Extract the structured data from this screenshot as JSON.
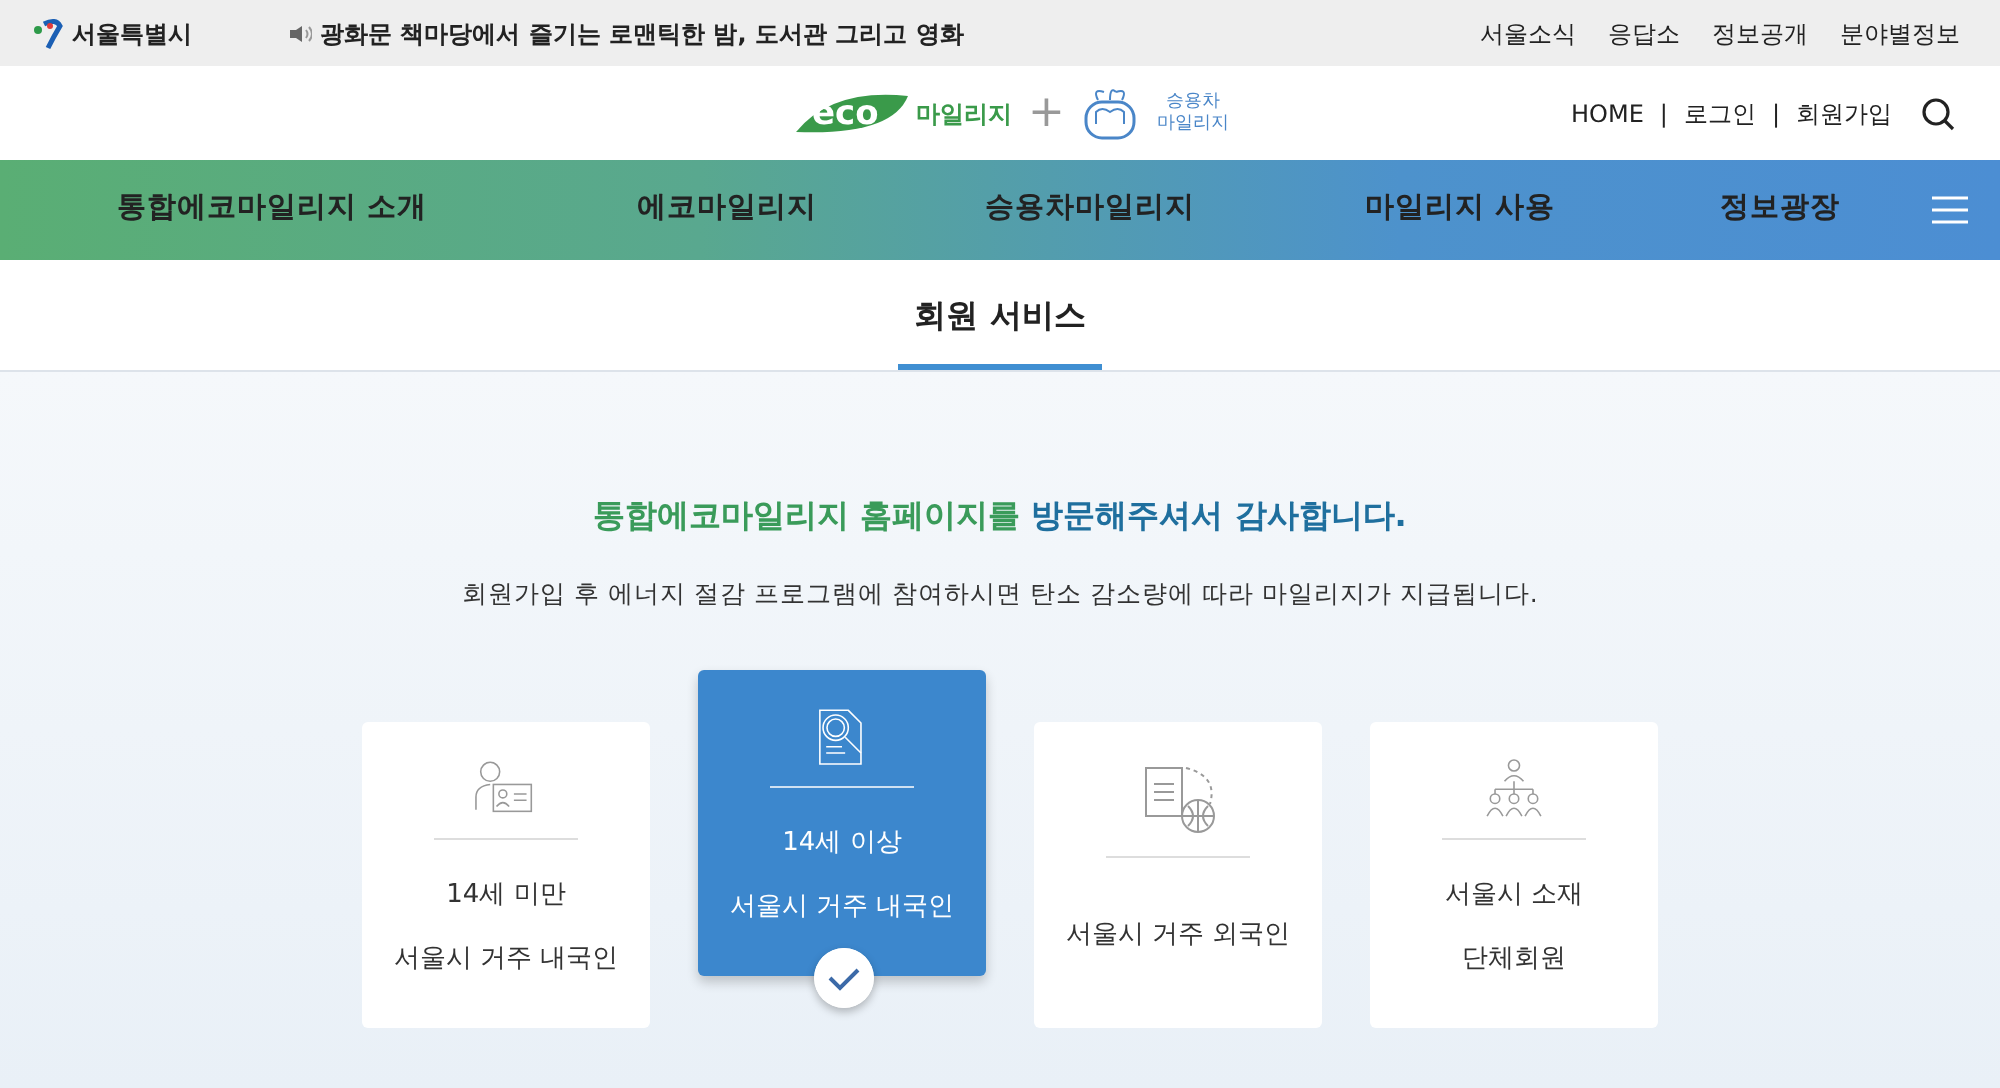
{
  "topbar": {
    "city_logo": "서울특별시",
    "notice": "광화문 책마당에서 즐기는 로맨틱한 밤, 도서관 그리고 영화",
    "links": [
      "서울소식",
      "응답소",
      "정보공개",
      "분야별정보"
    ]
  },
  "header": {
    "eco_logo": {
      "mark": "eco",
      "text": "마일리지"
    },
    "car_logo": {
      "line1": "승용차",
      "line2": "마일리지"
    },
    "plus": "+",
    "util_links": [
      "HOME",
      "로그인",
      "회원가입"
    ],
    "separator": "|"
  },
  "nav": {
    "items": [
      "통합에코마일리지 소개",
      "에코마일리지",
      "승용차마일리지",
      "마일리지 사용",
      "정보광장"
    ]
  },
  "section_tabs": [
    {
      "label": "회원 서비스",
      "selected": true
    }
  ],
  "welcome": {
    "heading": [
      {
        "text": "통합에코마일리지 홈페이지를 ",
        "color": "#3a9b5a"
      },
      {
        "text": "방문해주셔서 감사합니다.",
        "color": "#1f6f9e"
      }
    ],
    "description": "회원가입 후 에너지 절감 프로그램에 참여하시면 탄소 감소량에 따라 마일리지가 지급됩니다."
  },
  "member_types": [
    {
      "kind": "child",
      "lines": [
        "14세 미만",
        "서울시 거주 내국인"
      ],
      "selected": false
    },
    {
      "kind": "adult",
      "lines": [
        "14세 이상",
        "서울시 거주 내국인"
      ],
      "selected": true
    },
    {
      "kind": "foreigner",
      "lines": [
        "서울시 거주 외국인"
      ],
      "selected": false
    },
    {
      "kind": "group",
      "lines": [
        "서울시 소재",
        "단체회원"
      ],
      "selected": false
    }
  ]
}
